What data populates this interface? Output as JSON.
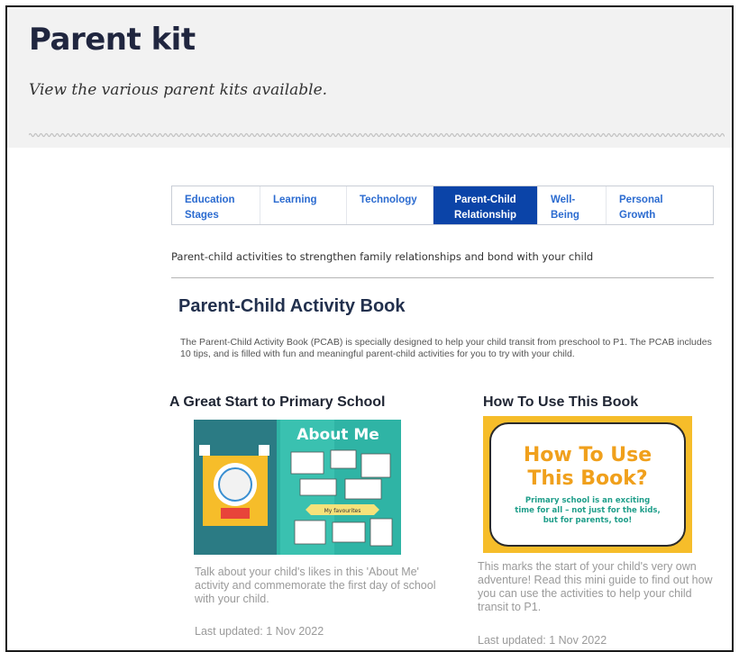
{
  "page": {
    "title": "Parent kit",
    "subtitle": "View the various parent kits available."
  },
  "tabs": [
    {
      "label": "Education Stages",
      "active": false
    },
    {
      "label": "Learning",
      "active": false
    },
    {
      "label": "Technology",
      "active": false
    },
    {
      "label": "Parent-Child Relationship",
      "active": true
    },
    {
      "label": "Well-Being",
      "active": false
    },
    {
      "label": "Personal Growth",
      "active": false
    }
  ],
  "category": {
    "description": "Parent-child activities to strengthen family relationships and bond with your child"
  },
  "book": {
    "title": "Parent-Child Activity Book",
    "description": "The Parent-Child Activity Book (PCAB) is specially designed to help your child transit from preschool to P1. The PCAB includes 10 tips, and is filled with fun and meaningful parent-child activities for you to try with your child."
  },
  "cards": [
    {
      "title": "A Great Start to Primary School",
      "image_text": {
        "heading": "About Me",
        "ribbon": "My favourites"
      },
      "description": "Talk about your child's likes in this 'About Me' activity and commemorate the first day of school with your child.",
      "updated": "Last updated: 1 Nov 2022"
    },
    {
      "title": "How To Use This Book",
      "image_text": {
        "heading_line1": "How To Use",
        "heading_line2": "This Book?",
        "body_line1": "Primary school is an exciting",
        "body_line2": "time for all – not just for the kids,",
        "body_line3": "but for parents, too!"
      },
      "description": "This marks the start of your child's very own adventure! Read this mini guide to find out how you can use the activities to help your child transit to P1.",
      "updated": "Last updated: 1 Nov 2022"
    }
  ],
  "colors": {
    "title": "#20263f",
    "tab_text": "#2b6bd0",
    "tab_active_bg": "#0b44a8",
    "header_band": "#f2f2f2",
    "thumb_teal": "#2fb4a5",
    "thumb_dark_teal": "#2b7b84",
    "thumb_yellow": "#f6bd2a",
    "thumb_text_orange": "#f0a01c",
    "thumb_text_teal": "#1f9e8a"
  }
}
